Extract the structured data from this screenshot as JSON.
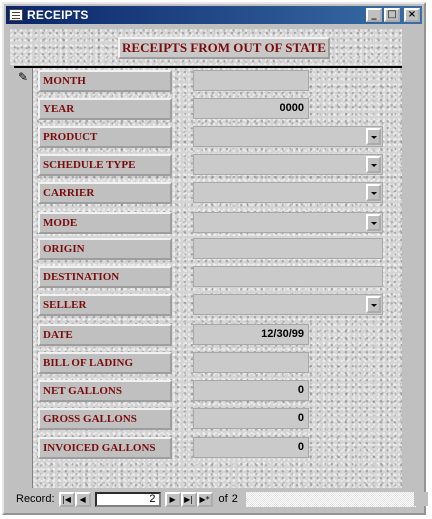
{
  "window": {
    "title": "RECEIPTS",
    "min": "_",
    "max": "□",
    "close": "×"
  },
  "header": {
    "title": "RECEIPTS FROM OUT OF STATE"
  },
  "fields": [
    {
      "label": "MONTH",
      "value": ""
    },
    {
      "label": "YEAR",
      "value": "0000"
    },
    {
      "label": "PRODUCT",
      "value": ""
    },
    {
      "label": "SCHEDULE TYPE",
      "value": ""
    },
    {
      "label": "CARRIER",
      "value": ""
    },
    {
      "label": "MODE",
      "value": ""
    },
    {
      "label": "ORIGIN",
      "value": ""
    },
    {
      "label": "DESTINATION",
      "value": ""
    },
    {
      "label": "SELLER",
      "value": ""
    },
    {
      "label": "DATE",
      "value": "12/30/99"
    },
    {
      "label": "BILL OF LADING",
      "value": ""
    },
    {
      "label": "NET GALLONS",
      "value": "0"
    },
    {
      "label": "GROSS GALLONS",
      "value": "0"
    },
    {
      "label": "INVOICED GALLONS",
      "value": "0"
    }
  ],
  "navigation": {
    "label": "Record:",
    "current": "2",
    "of_label": "of",
    "total": "2",
    "first": "|◀",
    "prev": "◀",
    "next": "▶",
    "last": "▶|",
    "new": "▶*"
  },
  "colors": {
    "label_text": "#7b0b0b",
    "title_bar": "#0a246a"
  }
}
